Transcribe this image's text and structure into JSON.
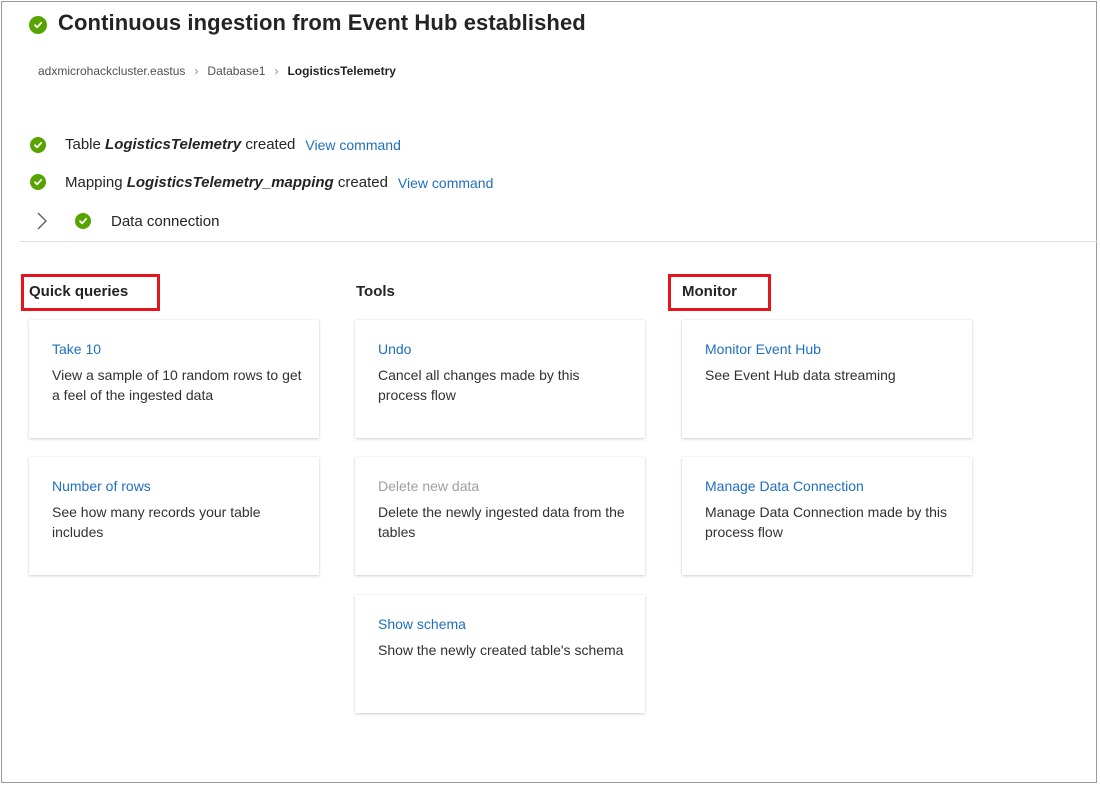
{
  "header": {
    "title": "Continuous ingestion from Event Hub established"
  },
  "breadcrumb": {
    "items": [
      "adxmicrohackcluster.eastus",
      "Database1",
      "LogisticsTelemetry"
    ]
  },
  "status": {
    "table": {
      "prefix": "Table ",
      "name": "LogisticsTelemetry",
      "suffix": " created",
      "link": "View command"
    },
    "mapping": {
      "prefix": "Mapping ",
      "name": "LogisticsTelemetry_mapping",
      "suffix": " created",
      "link": "View command"
    },
    "connection": {
      "label": "Data connection"
    }
  },
  "sections": {
    "quick_queries": {
      "title": "Quick queries",
      "cards": [
        {
          "title": "Take 10",
          "desc": "View a sample of 10 random rows to get a feel of the ingested data"
        },
        {
          "title": "Number of rows",
          "desc": "See how many records your table includes"
        }
      ]
    },
    "tools": {
      "title": "Tools",
      "cards": [
        {
          "title": "Undo",
          "desc": "Cancel all changes made by this process flow"
        },
        {
          "title": "Delete new data",
          "desc": "Delete the newly ingested data from the tables"
        },
        {
          "title": "Show schema",
          "desc": "Show the newly created table's schema"
        }
      ]
    },
    "monitor": {
      "title": "Monitor",
      "cards": [
        {
          "title": "Monitor Event Hub",
          "desc": "See Event Hub data streaming"
        },
        {
          "title": "Manage Data Connection",
          "desc": "Manage Data Connection made by this process flow"
        }
      ]
    }
  },
  "colors": {
    "success": "#57a300",
    "link": "#1f6fbf",
    "highlight": "#e8141d",
    "disabled": "#a19f9d"
  }
}
